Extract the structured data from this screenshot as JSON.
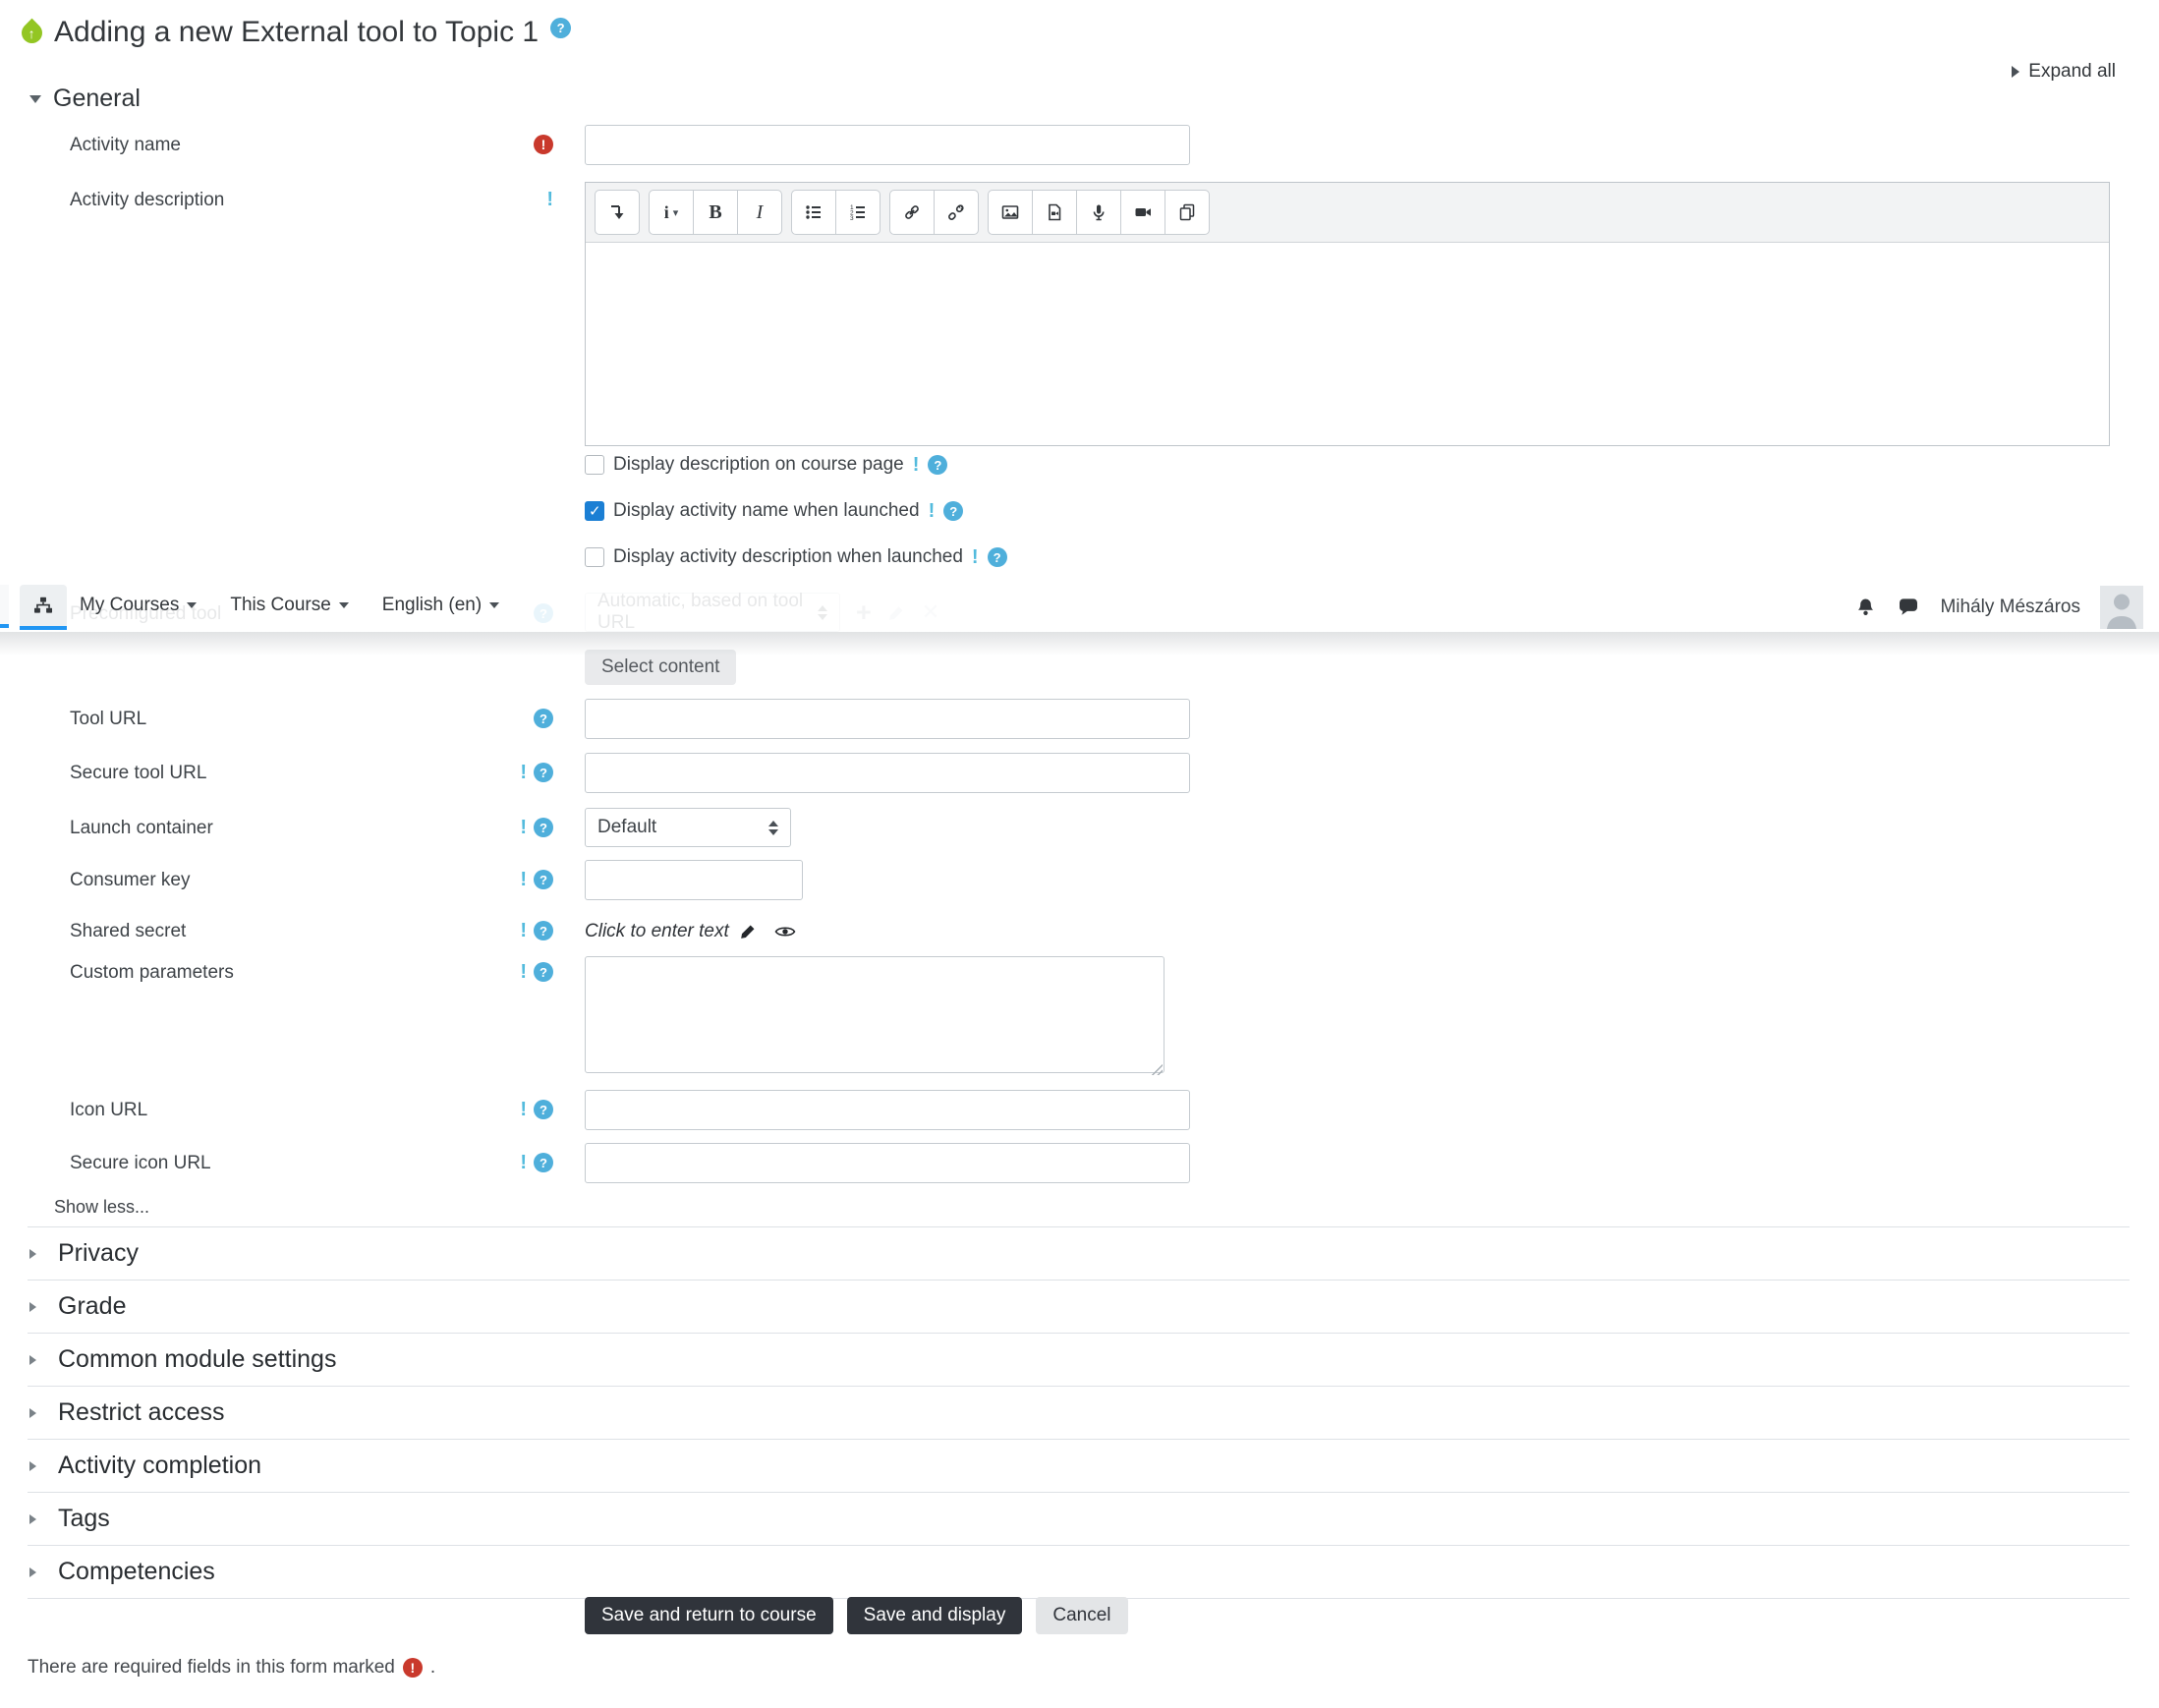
{
  "header": {
    "title": "Adding a new External tool to Topic 1",
    "expand_all": "Expand all"
  },
  "navbar": {
    "menus": [
      {
        "label": "My Courses"
      },
      {
        "label": "This Course"
      },
      {
        "label": "English (en)"
      }
    ],
    "user_name": "Mihály Mészáros",
    "icons": [
      "sitemap-icon",
      "bell-icon",
      "messages-icon",
      "avatar"
    ]
  },
  "form": {
    "general_heading": "General",
    "fields": {
      "activity_name": {
        "label": "Activity name",
        "value": "",
        "required": true
      },
      "activity_description": {
        "label": "Activity description",
        "value": ""
      },
      "display_description": {
        "label": "Display description on course page",
        "checked": false
      },
      "display_activity_name": {
        "label": "Display activity name when launched",
        "checked": true
      },
      "display_activity_description": {
        "label": "Display activity description when launched",
        "checked": false
      },
      "preconfigured_tool": {
        "label": "Preconfigured tool",
        "value": "Automatic, based on tool URL"
      },
      "tool_url": {
        "label": "Tool URL",
        "value": ""
      },
      "secure_tool_url": {
        "label": "Secure tool URL",
        "value": ""
      },
      "launch_container": {
        "label": "Launch container",
        "value": "Default"
      },
      "consumer_key": {
        "label": "Consumer key",
        "value": ""
      },
      "shared_secret": {
        "label": "Shared secret",
        "value": "Click to enter text"
      },
      "custom_parameters": {
        "label": "Custom parameters",
        "value": ""
      },
      "icon_url": {
        "label": "Icon URL",
        "value": ""
      },
      "secure_icon_url": {
        "label": "Secure icon URL",
        "value": ""
      }
    },
    "select_content_button": "Select content",
    "show_less": "Show less...",
    "collapsed_sections": [
      {
        "label": "Privacy"
      },
      {
        "label": "Grade"
      },
      {
        "label": "Common module settings"
      },
      {
        "label": "Restrict access"
      },
      {
        "label": "Activity completion"
      },
      {
        "label": "Tags"
      },
      {
        "label": "Competencies"
      }
    ],
    "buttons": {
      "save_return": "Save and return to course",
      "save_display": "Save and display",
      "cancel": "Cancel"
    },
    "required_note": {
      "text": "There are required fields in this form marked",
      "suffix": "."
    }
  },
  "editor": {
    "toolbar": [
      "collapse-toolbar-icon",
      "paragraph-styles-icon",
      "bold-icon",
      "italic-icon",
      "unordered-list-icon",
      "ordered-list-icon",
      "link-icon",
      "unlink-icon",
      "insert-image-icon",
      "insert-media-icon",
      "record-audio-icon",
      "record-video-icon",
      "manage-files-icon"
    ]
  },
  "colors": {
    "accent_blue": "#2196f3",
    "checkbox_blue": "#1b7fd4",
    "help_cyan": "#4fafdb",
    "required_red": "#c9392c",
    "button_dark": "#30343b",
    "tool_icon_green": "#93c623"
  }
}
